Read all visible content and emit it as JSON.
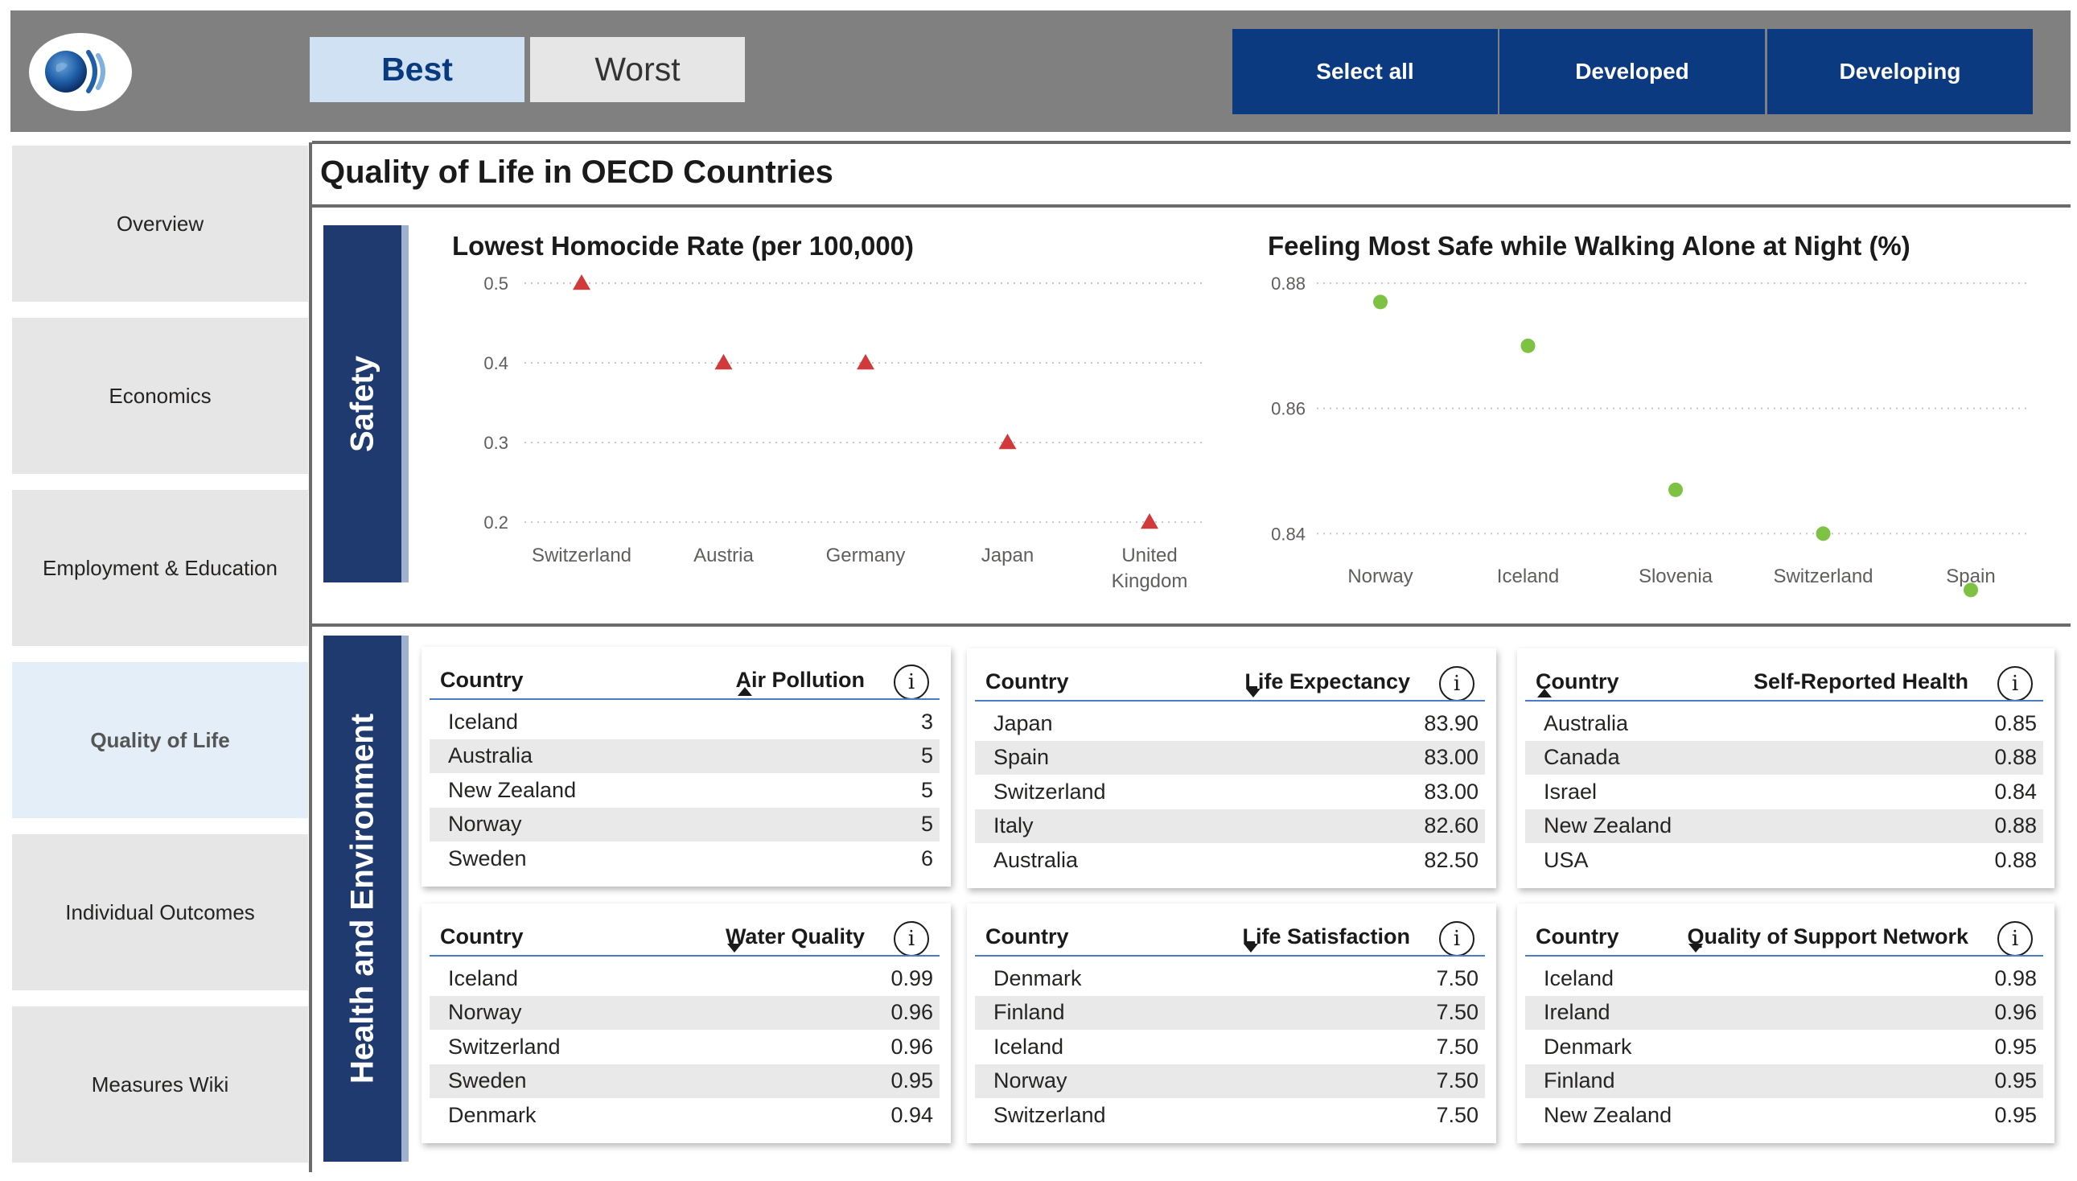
{
  "header": {
    "logo": "oecd-logo",
    "toggle": {
      "best": "Best",
      "worst": "Worst",
      "selected": "Best"
    },
    "filters": [
      "Select all",
      "Developed",
      "Developing"
    ]
  },
  "sidebar": {
    "items": [
      {
        "label": "Overview"
      },
      {
        "label": "Economics"
      },
      {
        "label": "Employment & Education"
      },
      {
        "label": "Quality of Life",
        "active": true
      },
      {
        "label": "Individual Outcomes"
      },
      {
        "label": "Measures Wiki"
      }
    ]
  },
  "page_title": "Quality of Life in OECD Countries",
  "sections": {
    "safety": "Safety",
    "health": "Health and Environment"
  },
  "colors": {
    "nav_active": "#e3eef8",
    "filter_bg": "#0b3a80",
    "section_bg": "#1f3a6e",
    "homicide_marker": "#d13a3a",
    "safe_marker": "#7dc242",
    "table_rule": "#4a7cc4"
  },
  "chart_data": [
    {
      "type": "scatter",
      "title": "Lowest Homocide Rate (per 100,000)",
      "categories": [
        "Switzerland",
        "Austria",
        "Germany",
        "Japan",
        "United Kingdom"
      ],
      "values": [
        0.5,
        0.4,
        0.4,
        0.3,
        0.2
      ],
      "yticks": [
        "0.5",
        "0.4",
        "0.3",
        "0.2"
      ],
      "ylim": [
        0.2,
        0.5
      ],
      "marker": "triangle",
      "grid": true
    },
    {
      "type": "scatter",
      "title": "Feeling Most Safe while Walking Alone at Night (%)",
      "categories": [
        "Norway",
        "Iceland",
        "Slovenia",
        "Switzerland",
        "Spain"
      ],
      "values": [
        0.877,
        0.87,
        0.847,
        0.84,
        0.831
      ],
      "yticks": [
        "0.88",
        "0.86",
        "0.84"
      ],
      "ylim": [
        0.834,
        0.88
      ],
      "marker": "circle",
      "grid": true
    }
  ],
  "tables": [
    {
      "col1": "Country",
      "col2": "Air Pollution",
      "info": "i",
      "sorted": "col2-up",
      "rows": [
        [
          "Iceland",
          "3"
        ],
        [
          "Australia",
          "5"
        ],
        [
          "New Zealand",
          "5"
        ],
        [
          "Norway",
          "5"
        ],
        [
          "Sweden",
          "6"
        ]
      ]
    },
    {
      "col1": "Country",
      "col2": "Life Expectancy",
      "info": "i",
      "sorted": "col2-down",
      "rows": [
        [
          "Japan",
          "83.90"
        ],
        [
          "Spain",
          "83.00"
        ],
        [
          "Switzerland",
          "83.00"
        ],
        [
          "Italy",
          "82.60"
        ],
        [
          "Australia",
          "82.50"
        ]
      ]
    },
    {
      "col1": "Country",
      "col2": "Self-Reported Health",
      "info": "i",
      "sorted": "col1-up",
      "rows": [
        [
          "Australia",
          "0.85"
        ],
        [
          "Canada",
          "0.88"
        ],
        [
          "Israel",
          "0.84"
        ],
        [
          "New Zealand",
          "0.88"
        ],
        [
          "USA",
          "0.88"
        ]
      ]
    },
    {
      "col1": "Country",
      "col2": "Water Quality",
      "info": "i",
      "sorted": "col2-down",
      "rows": [
        [
          "Iceland",
          "0.99"
        ],
        [
          "Norway",
          "0.96"
        ],
        [
          "Switzerland",
          "0.96"
        ],
        [
          "Sweden",
          "0.95"
        ],
        [
          "Denmark",
          "0.94"
        ]
      ]
    },
    {
      "col1": "Country",
      "col2": "Life Satisfaction",
      "info": "i",
      "sorted": "col2-down",
      "rows": [
        [
          "Denmark",
          "7.50"
        ],
        [
          "Finland",
          "7.50"
        ],
        [
          "Iceland",
          "7.50"
        ],
        [
          "Norway",
          "7.50"
        ],
        [
          "Switzerland",
          "7.50"
        ]
      ]
    },
    {
      "col1": "Country",
      "col2": "Quality of Support Network",
      "info": "i",
      "sorted": "col2-down",
      "rows": [
        [
          "Iceland",
          "0.98"
        ],
        [
          "Ireland",
          "0.96"
        ],
        [
          "Denmark",
          "0.95"
        ],
        [
          "Finland",
          "0.95"
        ],
        [
          "New Zealand",
          "0.95"
        ]
      ]
    }
  ]
}
